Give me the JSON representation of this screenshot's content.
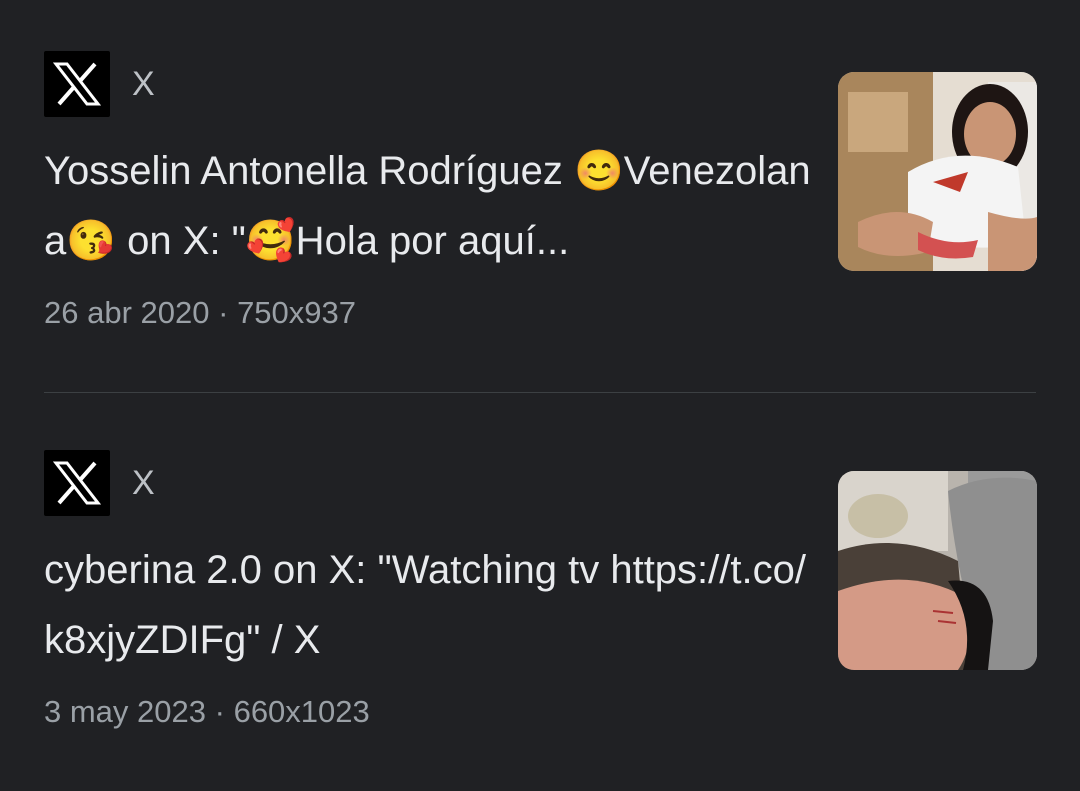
{
  "results": [
    {
      "source": {
        "icon": "x-logo-icon",
        "name": "X"
      },
      "title": "Yosselin Antonella Rodríguez 😊Venezolana😘 on X: \"🥰Hola por aquí...",
      "date": "26 abr 2020",
      "separator": "·",
      "dimensions": "750x937",
      "thumbnail": "thumbnail-image-selfie"
    },
    {
      "source": {
        "icon": "x-logo-icon",
        "name": "X"
      },
      "title": "cyberina 2.0 on X: \"Watching tv https://t.co/k8xjyZDIFg\" / X",
      "date": "3 may 2023",
      "separator": "·",
      "dimensions": "660x1023",
      "thumbnail": "thumbnail-image-photo"
    }
  ],
  "colors": {
    "background": "#202124",
    "title": "#e8eaed",
    "meta": "#9aa0a6",
    "divider": "#3c4043"
  }
}
